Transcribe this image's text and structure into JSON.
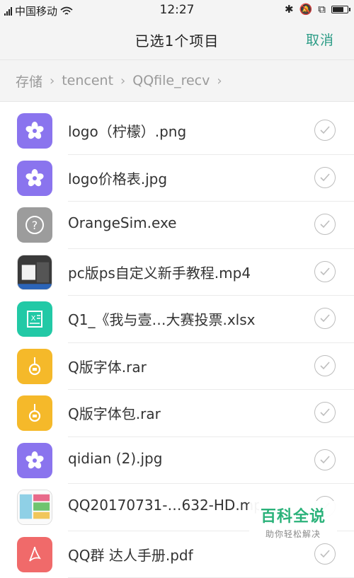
{
  "status_bar": {
    "carrier": "中国移动",
    "time": "12:27"
  },
  "header": {
    "title": "已选1个项目",
    "cancel_label": "取消"
  },
  "breadcrumb": [
    "存储",
    "tencent",
    "QQfile_recv"
  ],
  "files": [
    {
      "name": "logo（柠檬）.png",
      "icon": "image-icon"
    },
    {
      "name": "logo价格表.jpg",
      "icon": "image-icon"
    },
    {
      "name": "OrangeSim.exe",
      "icon": "unknown-file-icon"
    },
    {
      "name": "pc版ps自定义新手教程.mp4",
      "icon": "video-thumbnail"
    },
    {
      "name": "Q1_《我与壹…大赛投票.xlsx",
      "icon": "excel-icon"
    },
    {
      "name": "Q版字体.rar",
      "icon": "archive-icon"
    },
    {
      "name": "Q版字体包.rar",
      "icon": "archive-icon"
    },
    {
      "name": "qidian (2).jpg",
      "icon": "image-icon"
    },
    {
      "name": "QQ20170731-…632-HD.mp4",
      "icon": "video-thumbnail"
    },
    {
      "name": "QQ群 达人手册.pdf",
      "icon": "pdf-icon"
    }
  ],
  "watermark": {
    "main": "百科全说",
    "sub": "助你轻松解决"
  },
  "colors": {
    "accent": "#2c9c86",
    "image": "#8a74ee",
    "excel": "#22c9a6",
    "archive": "#f5b92a",
    "pdf": "#f06a6a"
  }
}
